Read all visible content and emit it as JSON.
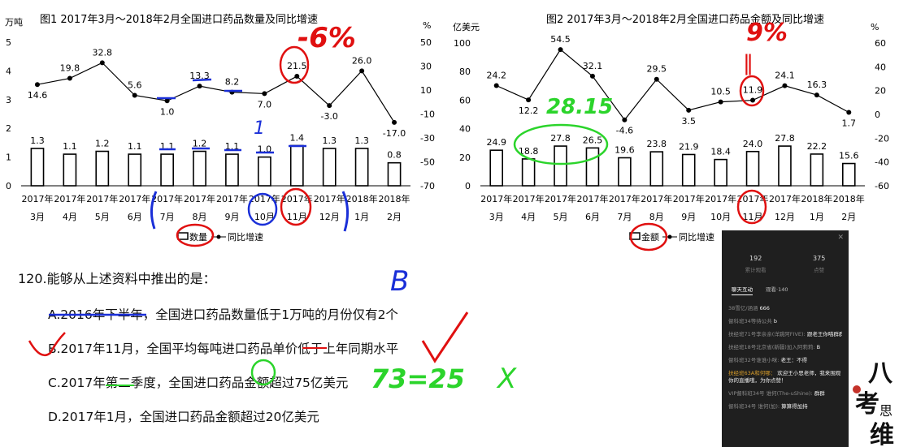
{
  "chart_data": [
    {
      "type": "bar",
      "title": "图1  2017年3月～2018年2月全国进口药品数量及同比增速",
      "ylabel": "万吨",
      "y2label": "%",
      "ylim": [
        0,
        5
      ],
      "y2lim": [
        -70,
        50
      ],
      "yticks": [
        0,
        1,
        2,
        3,
        4,
        5
      ],
      "y2ticks": [
        50,
        30,
        10,
        -10,
        -30,
        -50,
        -70
      ],
      "categories": [
        [
          "2017年",
          "3月"
        ],
        [
          "2017年",
          "4月"
        ],
        [
          "2017年",
          "5月"
        ],
        [
          "2017年",
          "6月"
        ],
        [
          "2017年",
          "7月"
        ],
        [
          "2017年",
          "8月"
        ],
        [
          "2017年",
          "9月"
        ],
        [
          "2017年",
          "10月"
        ],
        [
          "2017年",
          "11月"
        ],
        [
          "2017年",
          "12月"
        ],
        [
          "2018年",
          "1月"
        ],
        [
          "2018年",
          "2月"
        ]
      ],
      "series": [
        {
          "name": "数量",
          "type": "bar",
          "values": [
            1.3,
            1.1,
            1.2,
            1.1,
            1.1,
            1.2,
            1.1,
            1.0,
            1.4,
            1.3,
            1.3,
            0.8
          ]
        },
        {
          "name": "同比增速",
          "type": "line",
          "values": [
            14.6,
            19.8,
            32.8,
            5.6,
            1.0,
            13.3,
            8.2,
            7.0,
            21.5,
            -3.0,
            26.0,
            -17.0
          ]
        }
      ],
      "legend": "bottom"
    },
    {
      "type": "bar",
      "title": "图2  2017年3月～2018年2月全国进口药品金额及同比增速",
      "ylabel": "亿美元",
      "y2label": "%",
      "ylim": [
        0,
        100
      ],
      "y2lim": [
        -60,
        60
      ],
      "yticks": [
        0,
        20,
        40,
        60,
        80,
        100
      ],
      "y2ticks": [
        60,
        40,
        20,
        0,
        -20,
        -40,
        -60
      ],
      "categories": [
        [
          "2017年",
          "3月"
        ],
        [
          "2017年",
          "4月"
        ],
        [
          "2017年",
          "5月"
        ],
        [
          "2017年",
          "6月"
        ],
        [
          "2017年",
          "7月"
        ],
        [
          "2017年",
          "8月"
        ],
        [
          "2017年",
          "9月"
        ],
        [
          "2017年",
          "10月"
        ],
        [
          "2017年",
          "11月"
        ],
        [
          "2017年",
          "12月"
        ],
        [
          "2018年",
          "1月"
        ],
        [
          "2018年",
          "2月"
        ]
      ],
      "series": [
        {
          "name": "金额",
          "type": "bar",
          "values": [
            24.9,
            18.8,
            27.8,
            26.5,
            19.6,
            23.8,
            21.9,
            18.4,
            24.0,
            27.8,
            22.2,
            15.6
          ]
        },
        {
          "name": "同比增速",
          "type": "line",
          "values": [
            24.2,
            12.2,
            54.5,
            32.1,
            -4.6,
            29.5,
            3.5,
            10.5,
            11.9,
            24.1,
            16.3,
            1.7
          ]
        }
      ],
      "legend": "bottom"
    }
  ],
  "question": {
    "stem": "120.能够从上述资料中推出的是：",
    "options": [
      "A.2016年下半年，全国进口药品数量低于1万吨的月份仅有2个",
      "B.2017年11月，全国平均每吨进口药品单价低于上年同期水平",
      "C.2017年第二季度，全国进口药品金额超过75亿美元",
      "D.2017年1月，全国进口药品金额超过20亿美元"
    ]
  },
  "annotations": {
    "chart1_pct": "-6%",
    "chart2_pct": "9%",
    "chart2_equal": "‖",
    "sum_label": "28.15",
    "answer_mark": "B",
    "tick_one": "1",
    "calc_c": "73=25",
    "cross": "X"
  },
  "live_panel": {
    "stats": [
      {
        "value": "192",
        "label": "累计观看"
      },
      {
        "value": "375",
        "label": "点赞"
      }
    ],
    "tabs": [
      "聊天互动",
      "观看·140"
    ],
    "messages": [
      {
        "user": "38雪亿/涵涵",
        "text": "666",
        "hl": false
      },
      {
        "user": "督科班34等待公共",
        "text": "b",
        "hl": false
      },
      {
        "user": "扶经班71号李亲亲(洋跳阿FIVE):",
        "text": "跟老王你喵群群",
        "hl": false
      },
      {
        "user": "扶经班18号北京省(新疆)加入阿莉莉:",
        "text": "B",
        "hl": false
      },
      {
        "user": "督科班32号谁谁小咪:",
        "text": "老王：不得",
        "hl": false
      },
      {
        "user": "扶经班63A和何哪：",
        "text": "欢迎王小思老师，我来围观你的直播哦，为你点赞！",
        "hl": true
      },
      {
        "user": "VIP督科班34号 谁何(The-uShine):",
        "text": "群群",
        "hl": false
      },
      {
        "user": "督科班34号 谁何(加):",
        "text": "算算得加持",
        "hl": false
      }
    ]
  },
  "logo_text": [
    "八",
    "考",
    "思",
    "维"
  ]
}
